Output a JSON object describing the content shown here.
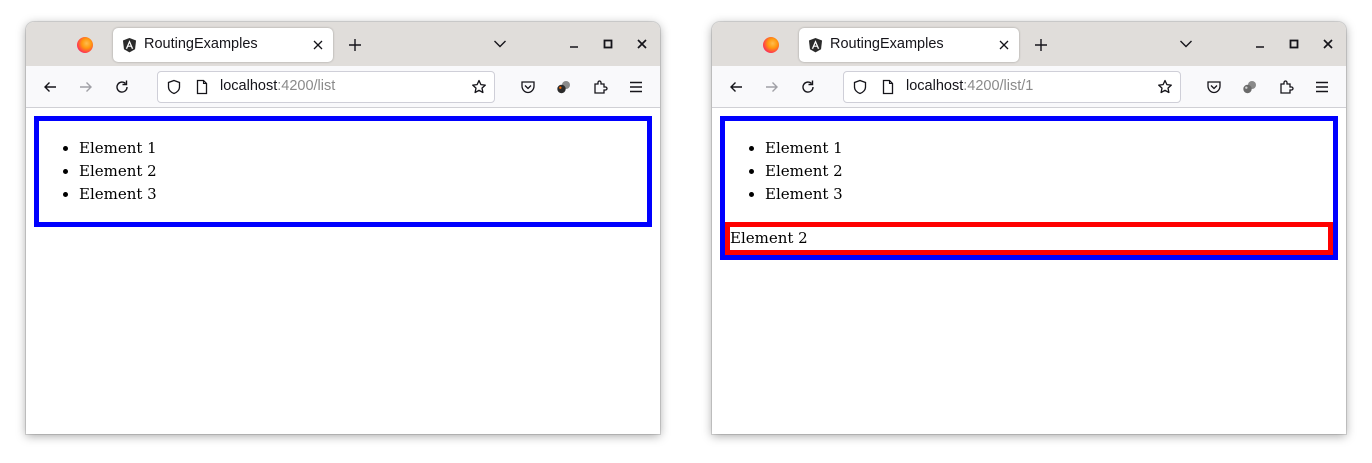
{
  "windows": [
    {
      "tab_title": "RoutingExamples",
      "url_host": "localhost",
      "url_path": ":4200/list",
      "list_items": [
        "Element 1",
        "Element 2",
        "Element 3"
      ]
    },
    {
      "tab_title": "RoutingExamples",
      "url_host": "localhost",
      "url_path": ":4200/list/1",
      "list_items": [
        "Element 1",
        "Element 2",
        "Element 3"
      ],
      "detail_text": "Element 2"
    }
  ],
  "colors": {
    "list_border": "#0000ff",
    "detail_border": "#ff0000",
    "tabbar_bg": "#e0ddda",
    "navbar_bg": "#f9f9fb"
  },
  "icons": [
    "firefox-icon",
    "angular-icon",
    "close-tab-icon",
    "new-tab-icon",
    "tab-list-icon",
    "minimize-icon",
    "maximize-icon",
    "close-window-icon",
    "back-icon",
    "forward-icon",
    "reload-icon",
    "shield-icon",
    "page-icon",
    "bookmark-star-icon",
    "pocket-icon",
    "extension-icon",
    "puzzle-icon",
    "menu-icon"
  ]
}
